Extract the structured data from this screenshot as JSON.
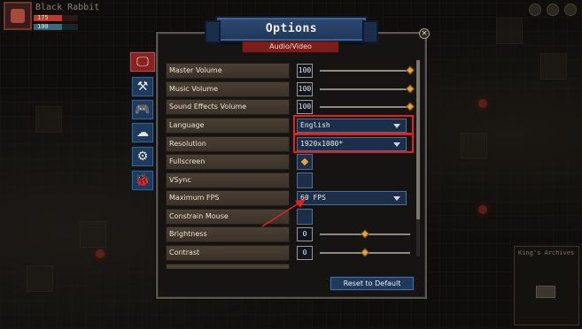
{
  "hud": {
    "player_name": "Black Rabbit",
    "hp_text": "175",
    "mp_text": "100"
  },
  "minimap": {
    "title": "King's Archives"
  },
  "options": {
    "title": "Options",
    "subtab": "Audio/Video",
    "reset_label": "Reset to Default",
    "close_glyph": "×"
  },
  "tabs": [
    {
      "name": "audio-video",
      "glyph": "🖵",
      "active": true
    },
    {
      "name": "gameplay",
      "glyph": "⚒",
      "active": false
    },
    {
      "name": "controls",
      "glyph": "🎮",
      "active": false
    },
    {
      "name": "interface",
      "glyph": "☁",
      "active": false
    },
    {
      "name": "settings",
      "glyph": "⚙",
      "active": false
    },
    {
      "name": "debug",
      "glyph": "🐞",
      "active": false
    }
  ],
  "rows": [
    {
      "label": "Master Volume",
      "type": "slider",
      "value": "100",
      "level": 1.0
    },
    {
      "label": "Music Volume",
      "type": "slider",
      "value": "100",
      "level": 1.0
    },
    {
      "label": "Sound Effects Volume",
      "type": "slider",
      "value": "100",
      "level": 1.0
    },
    {
      "label": "Language",
      "type": "dropdown",
      "value": "English"
    },
    {
      "label": "Resolution",
      "type": "dropdown",
      "value": "1920x1080*"
    },
    {
      "label": "Fullscreen",
      "type": "checkbox",
      "checked": true
    },
    {
      "label": "VSync",
      "type": "checkbox",
      "checked": false
    },
    {
      "label": "Maximum FPS",
      "type": "dropdown",
      "value": "60 FPS"
    },
    {
      "label": "Constrain Mouse",
      "type": "checkbox",
      "checked": false
    },
    {
      "label": "Brightness",
      "type": "slider",
      "value": "0",
      "level": 0.5
    },
    {
      "label": "Contrast",
      "type": "slider",
      "value": "0",
      "level": 0.5
    }
  ],
  "colors": {
    "accent_orange": "#e9a33a",
    "banner_blue": "#2d4a73",
    "active_tab_red": "#8a231e",
    "highlight_red": "#e0231f"
  }
}
